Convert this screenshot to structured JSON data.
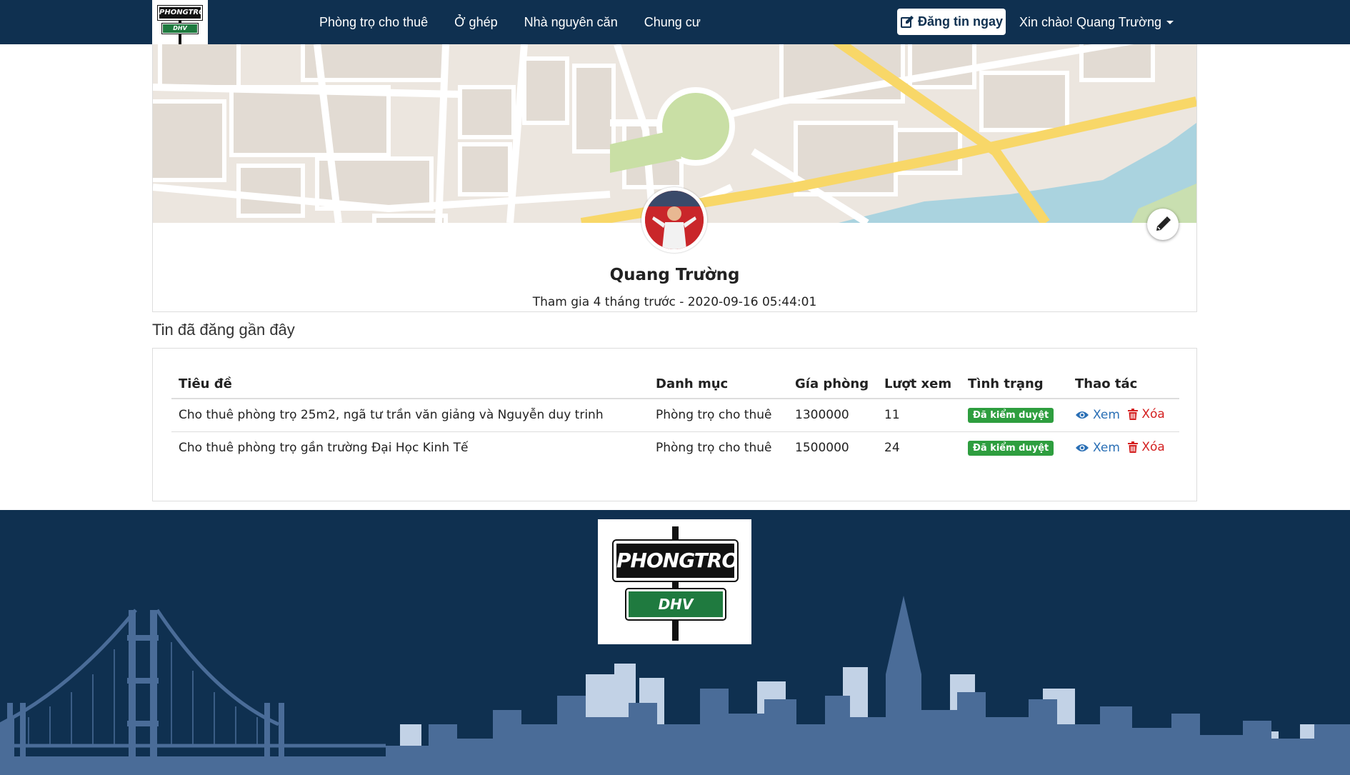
{
  "header": {
    "logo_top": "PHONGTRO",
    "logo_bottom": "DHV",
    "nav": [
      "Phòng trọ cho thuê",
      "Ở ghép",
      "Nhà nguyên căn",
      "Chung cư"
    ],
    "post_button": "Đăng tin ngay",
    "greeting": "Xin chào! Quang Trường"
  },
  "profile": {
    "name": "Quang Trường",
    "joined": "Tham gia 4 tháng trước - 2020-09-16 05:44:01"
  },
  "recent": {
    "title": "Tin đã đăng gần đây",
    "columns": [
      "Tiêu đề",
      "Danh mục",
      "Gía phòng",
      "Lượt xem",
      "Tình trạng",
      "Thao tác"
    ],
    "rows": [
      {
        "title": "Cho thuê phòng trọ 25m2, ngã tư trần văn giảng và Nguyễn duy trinh",
        "category": "Phòng trọ cho thuê",
        "price": "1300000",
        "views": "11",
        "status": "Đã kiểm duyệt",
        "view_label": "Xem",
        "delete_label": "Xóa"
      },
      {
        "title": "Cho thuê phòng trọ gần trường Đại Học Kinh Tế",
        "category": "Phòng trọ cho thuê",
        "price": "1500000",
        "views": "24",
        "status": "Đã kiểm duyệt",
        "view_label": "Xem",
        "delete_label": "Xóa"
      }
    ]
  },
  "footer": {
    "logo_top": "PHONGTRO",
    "logo_bottom": "DHV"
  },
  "colors": {
    "navbar": "#0f3050",
    "badge_green": "#2e9e3f",
    "view_blue": "#2a6fb5",
    "delete_red": "#d42020"
  }
}
